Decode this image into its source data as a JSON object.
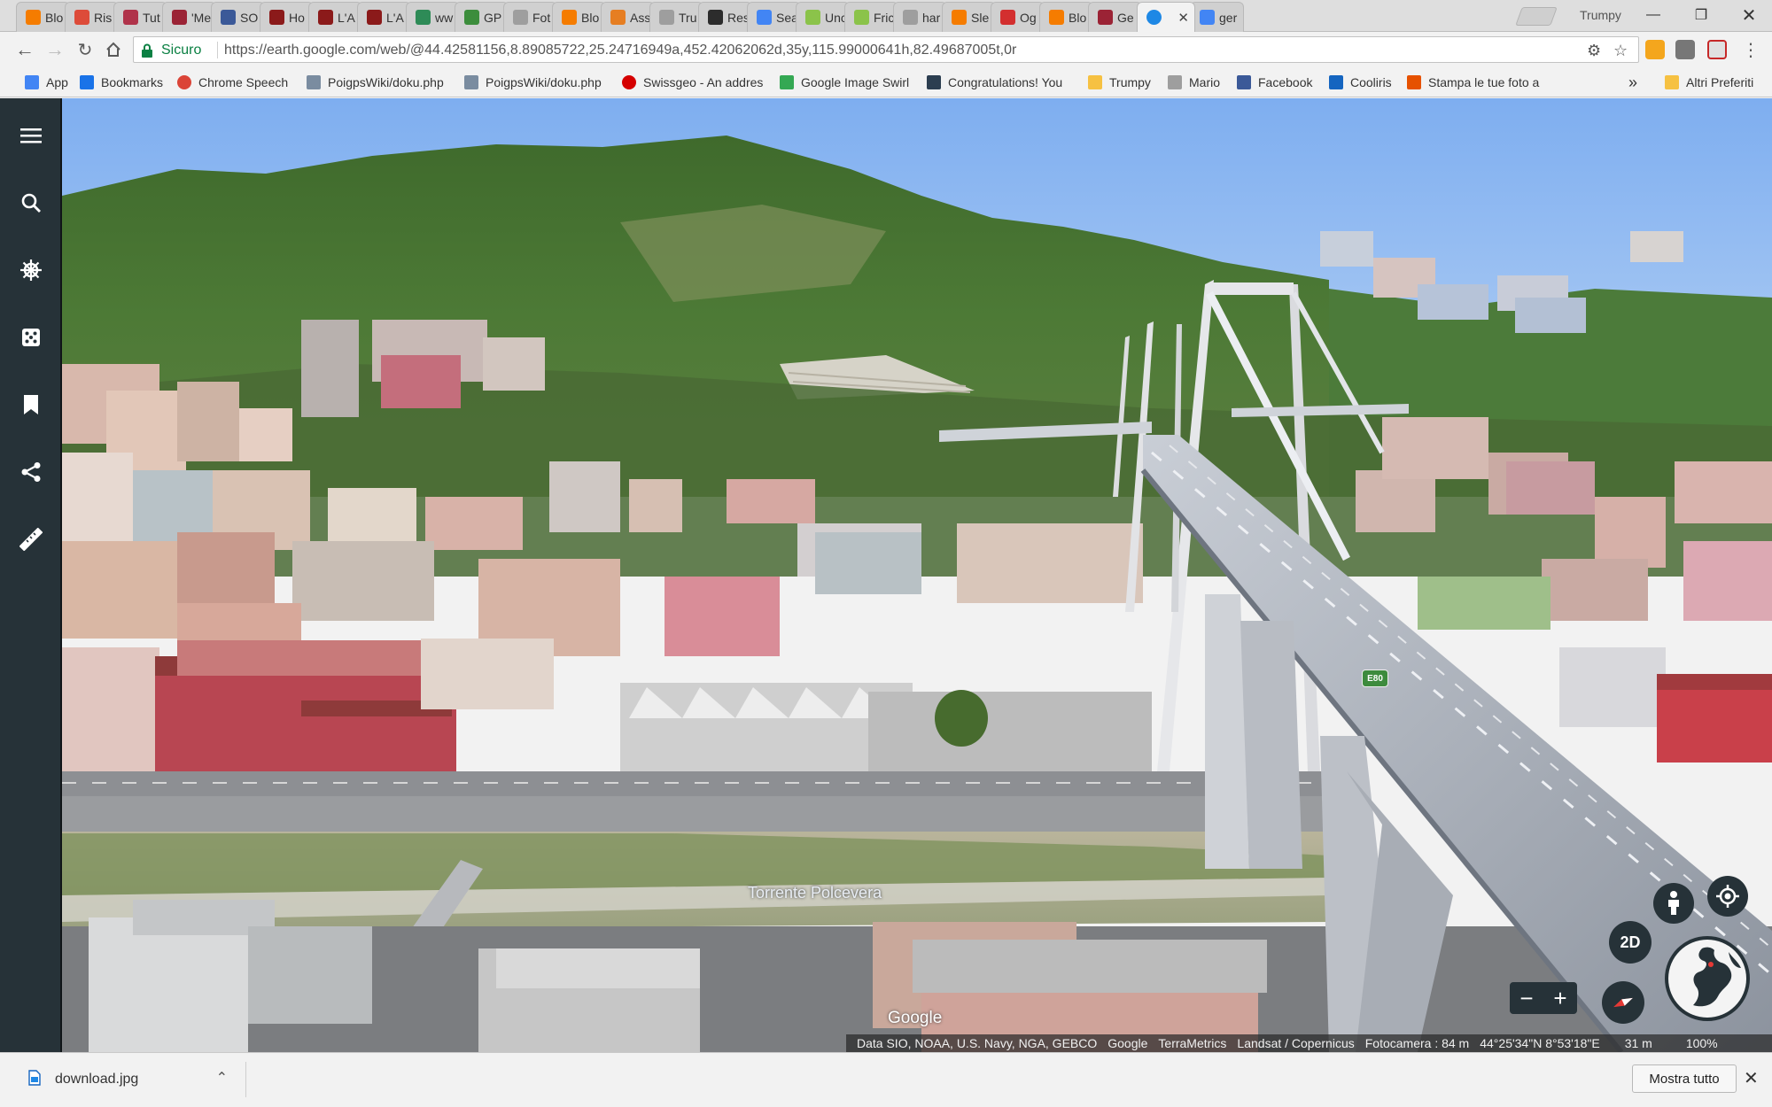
{
  "browser": {
    "profile_name": "Trumpy",
    "tabs": [
      {
        "title": "Blo",
        "icon": "blogger-icon",
        "color": "#f57c00"
      },
      {
        "title": "Ris",
        "icon": "google-plus-icon",
        "color": "#dd4b39"
      },
      {
        "title": "Tut",
        "icon": "puzzle-icon",
        "color": "#b0334a"
      },
      {
        "title": "'Me",
        "icon": "bird-icon",
        "color": "#9b2335"
      },
      {
        "title": "SO",
        "icon": "facebook-icon",
        "color": "#3b5998"
      },
      {
        "title": "Ho",
        "icon": "tower-icon",
        "color": "#8b1a1a"
      },
      {
        "title": "L'A",
        "icon": "tower-icon",
        "color": "#8b1a1a"
      },
      {
        "title": "L'A",
        "icon": "tower-icon",
        "color": "#8b1a1a"
      },
      {
        "title": "ww",
        "icon": "atom-icon",
        "color": "#2e8b57"
      },
      {
        "title": "GP",
        "icon": "gps-icon",
        "color": "#3c8d3c"
      },
      {
        "title": "Fot",
        "icon": "page-icon",
        "color": "#9e9e9e"
      },
      {
        "title": "Blo",
        "icon": "blogger-icon",
        "color": "#f57c00"
      },
      {
        "title": "Ass",
        "icon": "pinwheel-icon",
        "color": "#e67e22"
      },
      {
        "title": "Tru",
        "icon": "page-icon",
        "color": "#9e9e9e"
      },
      {
        "title": "Res",
        "icon": "researchgate-icon",
        "color": "#2c2c2c"
      },
      {
        "title": "Sea",
        "icon": "google-icon",
        "color": "#4285f4"
      },
      {
        "title": "Unc",
        "icon": "globe-icon",
        "color": "#8bc34a"
      },
      {
        "title": "Fric",
        "icon": "globe-icon",
        "color": "#8bc34a"
      },
      {
        "title": "har",
        "icon": "page-icon",
        "color": "#9e9e9e"
      },
      {
        "title": "Sle",
        "icon": "blogger-icon",
        "color": "#f57c00"
      },
      {
        "title": "Og",
        "icon": "fc-icon",
        "color": "#d32f2f"
      },
      {
        "title": "Blo",
        "icon": "blogger-icon",
        "color": "#f57c00"
      },
      {
        "title": "Ge",
        "icon": "bird-icon",
        "color": "#9b2335"
      },
      {
        "title": "",
        "icon": "earth-icon",
        "color": "#1e88e5",
        "active": true
      },
      {
        "title": "ger",
        "icon": "google-icon",
        "color": "#4285f4"
      }
    ],
    "toolbar": {
      "secure_label": "Sicuro",
      "url": "https://earth.google.com/web/@44.42581156,8.89085722,25.24716949a,452.42062062d,35y,115.99000641h,82.49687005t,0r"
    },
    "bookmarks": [
      {
        "label": "App",
        "icon": "apps-grid-icon",
        "color": "#4285f4"
      },
      {
        "label": "Bookmarks",
        "icon": "star-icon",
        "color": "#1a73e8"
      },
      {
        "label": "Chrome Speech",
        "icon": "chrome-icon",
        "color": "#db4437"
      },
      {
        "label": "PoigpsWiki/doku.php",
        "icon": "wiki-icon",
        "color": "#7a8ca0"
      },
      {
        "label": "PoigpsWiki/doku.php",
        "icon": "wiki-icon",
        "color": "#7a8ca0"
      },
      {
        "label": "Swissgeo - An addres",
        "icon": "red-dot-icon",
        "color": "#d50000"
      },
      {
        "label": "Google Image Swirl",
        "icon": "google-icon",
        "color": "#34a853"
      },
      {
        "label": "Congratulations! You",
        "icon": "x-icon",
        "color": "#2c3e50"
      },
      {
        "label": "Trumpy",
        "icon": "folder-icon",
        "color": "#f6c142"
      },
      {
        "label": "Mario",
        "icon": "page-icon",
        "color": "#9e9e9e"
      },
      {
        "label": "Facebook",
        "icon": "facebook-icon",
        "color": "#3b5998"
      },
      {
        "label": "Cooliris",
        "icon": "cooliris-icon",
        "color": "#1565c0"
      },
      {
        "label": "Stampa le tue foto a",
        "icon": "photo-icon",
        "color": "#e65100"
      }
    ],
    "bookmarks_overflow": "»",
    "other_bookmarks": "Altri Preferiti"
  },
  "earth": {
    "place_label": "Torrente Polcevera",
    "road_shield": "E80",
    "logo": "Google",
    "view_mode_button": "2D",
    "attribution": {
      "data_sources": "Data SIO, NOAA, U.S. Navy, NGA, GEBCO",
      "providers": [
        "Google",
        "TerraMetrics",
        "Landsat / Copernicus"
      ],
      "camera": "Fotocamera : 84 m",
      "coordinates": "44°25'34\"N 8°53'18\"E",
      "altitude": "31 m",
      "zoom": "100%"
    },
    "colors": {
      "sidebar": "#263238",
      "sky_top": "#7eaef0",
      "sky_bottom": "#b8d3f5"
    }
  },
  "downloads": {
    "file_name": "download.jpg",
    "show_all_label": "Mostra tutto"
  }
}
